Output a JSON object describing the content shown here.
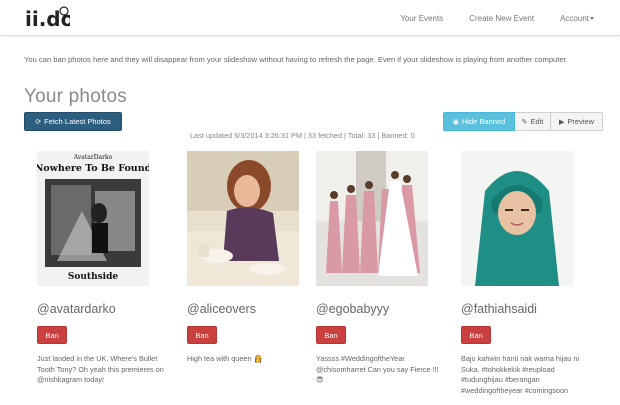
{
  "nav": {
    "logo_text": "ii.do",
    "links": [
      "Your Events",
      "Create New Event",
      "Account"
    ]
  },
  "intro_text": "You can ban photos here and they will disappear from your slideshow without having to refresh the page. Even if your slideshow is playing from another computer.",
  "heading": "Your photos",
  "buttons": {
    "fetch": "Fetch Latest Photos",
    "hide_banned": "Hide Banned",
    "edit": "Edit",
    "preview": "Preview"
  },
  "status_text": "Last updated 6/3/2014 3:26:31 PM | 33 fetched | Total: 33 | Banned: 0",
  "cards": [
    {
      "username": "@avatardarko",
      "ban_label": "Ban",
      "caption": "Just landed in the UK. Where's Bullet Tooth Tony? Oh yeah this premieres on @nishkagram today!",
      "poster_brand": "AvatarDarko",
      "poster_title": "Nowhere To Be Found",
      "poster_sub": "Southside"
    },
    {
      "username": "@aliceovers",
      "ban_label": "Ban",
      "caption": "High tea with queen 👸"
    },
    {
      "username": "@egobabyyy",
      "ban_label": "Ban",
      "caption": "Yassss #WeddingoftheYear @chisomharret Can you say Fierce !!! 😎"
    },
    {
      "username": "@fathiahsaidi",
      "ban_label": "Ban",
      "caption": "Baju kahwin hanti nak warna hijau ni Suka. #tohokkekik #reupload #tudunghijau #berangan #weddingoftheyear #comingsoon"
    }
  ],
  "colors": {
    "fetch_button": "#2c5f7f",
    "hide_banned_button": "#5bc0de",
    "ban_button": "#c9403f"
  }
}
